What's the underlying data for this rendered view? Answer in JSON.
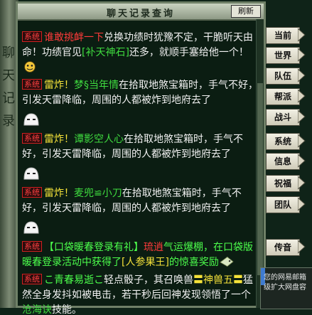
{
  "window": {
    "title": "聊天记录查询",
    "refresh_label": "刷新"
  },
  "tabs": [
    "当前",
    "世界",
    "队伍",
    "帮派",
    "战斗",
    "系统",
    "信息",
    "祝福",
    "团队",
    "传音"
  ],
  "messages": [
    {
      "tag": "系统",
      "parts": [
        {
          "text": "谁敢挑衅一下",
          "color": "red"
        },
        {
          "text": "兑换功绩时犹豫不定，干脆听天由命！功绩官见",
          "color": "white"
        },
        {
          "text": "[补天神石]",
          "color": "green"
        },
        {
          "text": "还多，就顺手塞给他一个！",
          "color": "white"
        }
      ],
      "emoji": "smile-emoji"
    },
    {
      "tag": "系统",
      "parts": [
        {
          "text": "雷炸！",
          "color": "yellow"
        },
        {
          "text": "梦§当年情",
          "color": "green"
        },
        {
          "text": "在拾取地煞宝箱时，手气不好，引发天雷降临，周围的人都被炸到地府去了",
          "color": "white"
        }
      ],
      "emoji": "ghost-emoji"
    },
    {
      "tag": "系统",
      "parts": [
        {
          "text": "雷炸！",
          "color": "yellow"
        },
        {
          "text": "谭影空人心",
          "color": "green"
        },
        {
          "text": "在拾取地煞宝箱时，手气不好，引发天雷降临，周围的人都被炸到地府去了",
          "color": "white"
        }
      ],
      "emoji": "ghost-emoji"
    },
    {
      "tag": "系统",
      "parts": [
        {
          "text": "雷炸！",
          "color": "yellow"
        },
        {
          "text": "麦兜≌小刀",
          "color": "green"
        },
        {
          "text": "在拾取地煞宝箱时，手气不好，引发天雷降临，周围的人都被炸到地府去了",
          "color": "white"
        }
      ],
      "emoji": "ghost-emoji"
    },
    {
      "tag": "系统",
      "parts": [
        {
          "text": "【口袋暖春登录有礼】",
          "color": "bright-green"
        },
        {
          "text": "琉逍",
          "color": "red"
        },
        {
          "text": "气运爆棚，在口袋版暖春登录活动中获得了",
          "color": "bright-green"
        },
        {
          "text": "[人参果王]",
          "color": "yellow"
        },
        {
          "text": "的惊喜奖励",
          "color": "bright-green"
        }
      ],
      "emoji": "bird-emoji"
    },
    {
      "tag": "系统",
      "parts": [
        {
          "text": "こ青春易逝こ",
          "color": "bright-green"
        },
        {
          "text": "轻点骰子，其召唤兽",
          "color": "white"
        },
        {
          "text": "〓神兽五〓",
          "color": "yellow"
        },
        {
          "text": "猛然全身发抖如被电击，若干秒后回神发现领悟了一个",
          "color": "white"
        },
        {
          "text": "沧海诀",
          "color": "green"
        },
        {
          "text": "技能。",
          "color": "white"
        }
      ],
      "emoji": ""
    }
  ],
  "left_scroll_glyphs": [
    "聊",
    "天",
    "记",
    "录"
  ],
  "popup": {
    "line1": "您的网易邮箱",
    "line2": "级扩大网盘容"
  },
  "colors": {
    "red": "#ff3b3b",
    "white": "#f2f2f2",
    "yellow": "#f5e23a",
    "green": "#3fdb3f",
    "bright-green": "#4cff4c"
  }
}
